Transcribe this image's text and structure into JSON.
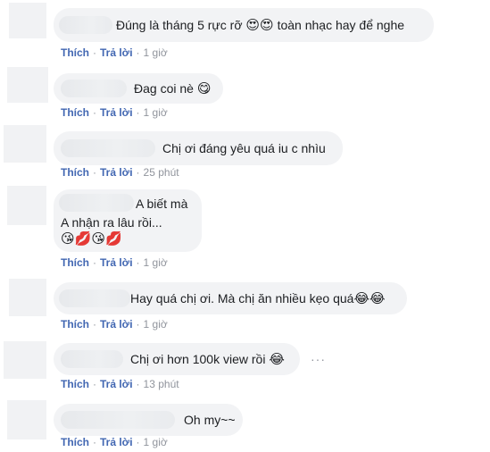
{
  "actions": {
    "like": "Thích",
    "reply": "Trả lời",
    "sep": "·"
  },
  "more_label": "···",
  "comments": [
    {
      "text": "Đúng là tháng 5 rực rỡ",
      "emoji": "😍😍",
      "text2": "toàn nhạc hay để nghe",
      "time": "1 giờ"
    },
    {
      "text": "Đag coi nè",
      "emoji": "😋",
      "time": "1 giờ"
    },
    {
      "text": "Chị ơi đáng yêu quá iu c nhìu",
      "time": "25 phút"
    },
    {
      "line1": "A biết mà",
      "line2": "A nhận ra lâu rồi...",
      "emoji": "😘💋😘💋",
      "time": "1 giờ"
    },
    {
      "text": "Hay quá chị ơi. Mà chị ăn nhiều kẹo quá",
      "emoji": "😂😂",
      "time": "1 giờ"
    },
    {
      "text": "Chị ơi hơn 100k view rồi",
      "emoji": "😂",
      "time": "13 phút"
    },
    {
      "text": "Oh my~~",
      "time": "1 giờ"
    }
  ]
}
